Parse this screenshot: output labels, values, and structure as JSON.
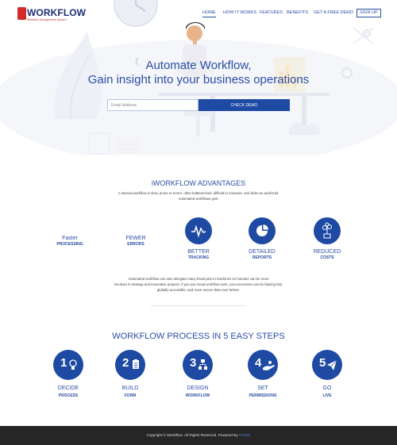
{
  "header": {
    "logo_title": "WORKFLOW",
    "logo_subtitle": "Workflow Management System",
    "nav": [
      {
        "label": "HOME"
      },
      {
        "label": "HOW IT WORKS"
      },
      {
        "label": "FEATURES"
      },
      {
        "label": "BENEFITS"
      },
      {
        "label": "GET A FREE DEMO"
      },
      {
        "label": "SIGN UP"
      }
    ]
  },
  "hero": {
    "title_line1": "Automate Workflow,",
    "title_line2": "Gain insight into your business operations",
    "email_placeholder": "Email Address",
    "cta_label": "CHECK DEMO"
  },
  "advantages": {
    "title": "iWORKFLOW ADVANTAGES",
    "desc_line1": "A manual workflow is slow, prone to errors, often bottlenecked, difficult to measure, and lacks an audit trail.",
    "desc_line2": "Automated workflows give:",
    "items": [
      {
        "label": "Faster",
        "sub": "PROCESSING"
      },
      {
        "label": "FEWER",
        "sub": "ERRORS"
      },
      {
        "label": "BETTER",
        "sub": "TRACKING"
      },
      {
        "label": "DETAILED",
        "sub": "REPORTS"
      },
      {
        "label": "REDUCED",
        "sub": "COSTS"
      }
    ],
    "body_line1": "Automated workflow can also delegate many trivial jobs to machines so humans can be more",
    "body_line2": "involved in strategy and innovative projects. If you use cloud workflow tools, your processes can be blazing fast,",
    "body_line3": "globally accessible, and more secure than ever before."
  },
  "steps": {
    "title": "WORKFLOW PROCESS IN 5 EASY STEPS",
    "items": [
      {
        "num": "1",
        "label": "DECIDE",
        "sub": "PROCESS"
      },
      {
        "num": "2",
        "label": "BUILD",
        "sub": "FORM"
      },
      {
        "num": "3",
        "label": "DESIGN",
        "sub": "WORKFLOW"
      },
      {
        "num": "4",
        "label": "SET",
        "sub": "PERMISSIONS"
      },
      {
        "num": "5",
        "label": "GO",
        "sub": "LIVE"
      }
    ]
  },
  "footer": {
    "text": "Copyright © iWorkflow. All Rights Reserved. Powered By",
    "link": "ICONS"
  },
  "colors": {
    "primary": "#1e4aa3",
    "heading": "#2a4ea4",
    "logo_red": "#d42a2a",
    "footer_bg": "#262626"
  }
}
